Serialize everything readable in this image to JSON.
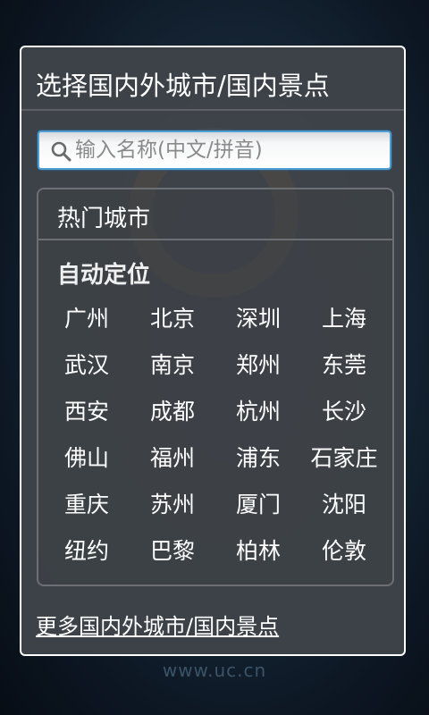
{
  "footer": {
    "watermark": "www.uc.cn"
  },
  "dialog": {
    "title": "选择国内外城市/国内景点",
    "search": {
      "placeholder": "输入名称(中文/拼音)",
      "value": ""
    },
    "hot_cities": {
      "title": "热门城市",
      "auto_locate": "自动定位",
      "cities": [
        "广州",
        "北京",
        "深圳",
        "上海",
        "武汉",
        "南京",
        "郑州",
        "东莞",
        "西安",
        "成都",
        "杭州",
        "长沙",
        "佛山",
        "福州",
        "浦东",
        "石家庄",
        "重庆",
        "苏州",
        "厦门",
        "沈阳",
        "纽约",
        "巴黎",
        "柏林",
        "伦敦"
      ]
    },
    "more_link": "更多国内外城市/国内景点"
  },
  "colors": {
    "dialog_bg": "#40444a",
    "dialog_border": "#ffffff",
    "search_focus": "#4d9fd6",
    "text": "#ffffff"
  },
  "icons": {
    "search": "search-icon"
  }
}
